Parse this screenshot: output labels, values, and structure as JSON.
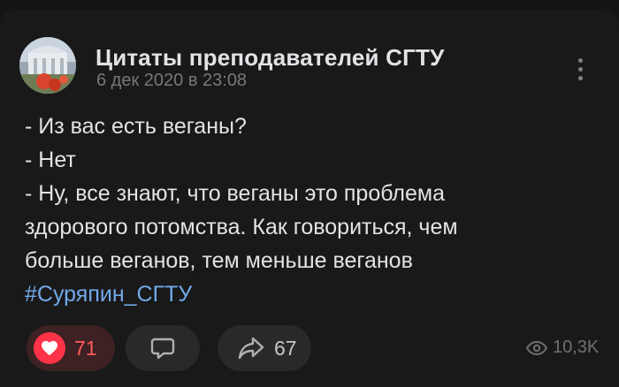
{
  "post": {
    "author": "Цитаты преподавателей СГТУ",
    "date": "6 дек 2020 в 23:08",
    "lines": [
      "- Из вас есть веганы?",
      "- Нет",
      "- Ну, все знают, что веганы это проблема",
      "здорового потомства. Как говориться, чем",
      "больше веганов, тем меньше веганов"
    ],
    "hashtag": "#Суряпин_СГТУ"
  },
  "actions": {
    "likes": "71",
    "shares": "67",
    "views": "10,3K"
  },
  "colors": {
    "background": "#191919",
    "like_accent": "#ff3347",
    "hashtag": "#71aaeb",
    "secondary_text": "#76787a"
  },
  "icons": {
    "like": "heart-icon",
    "comment": "comment-icon",
    "share": "share-arrow-icon",
    "views": "eye-icon",
    "menu": "more-vertical-icon"
  }
}
